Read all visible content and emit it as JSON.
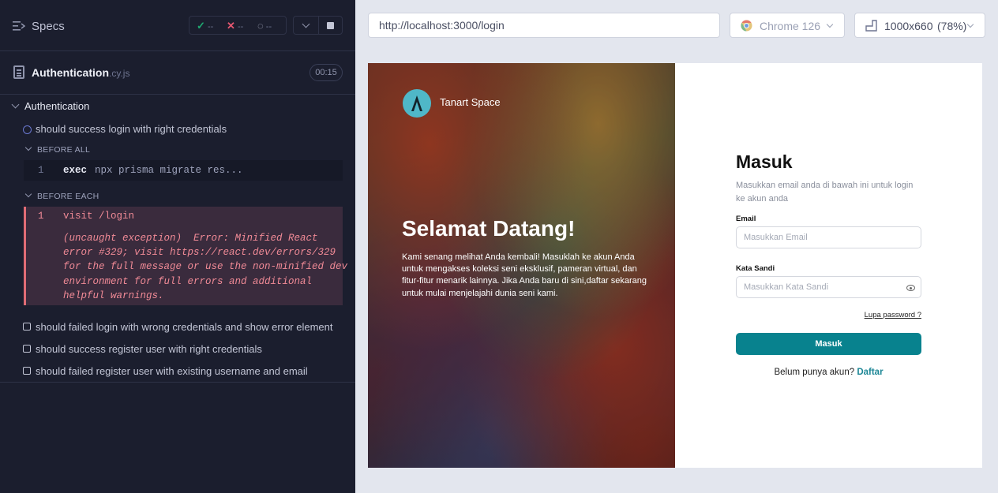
{
  "specs": {
    "title": "Specs",
    "stats": {
      "passed": "--",
      "failed": "--",
      "pending": "--"
    }
  },
  "spec_file": {
    "name": "Authentication",
    "ext": ".cy.js",
    "duration": "00:15"
  },
  "suite": {
    "name": "Authentication",
    "tests": [
      {
        "title": "should success login with right credentials",
        "state": "running"
      },
      {
        "title": "should failed login with wrong credentials and show error element",
        "state": "pending"
      },
      {
        "title": "should success register user with right credentials",
        "state": "pending"
      },
      {
        "title": "should failed register user with existing username and email",
        "state": "pending"
      }
    ],
    "before_all": {
      "label": "BEFORE ALL",
      "number": "1",
      "command": "exec",
      "message": "npx prisma migrate res..."
    },
    "before_each": {
      "label": "BEFORE EACH",
      "number": "1",
      "command": "visit",
      "message": "/login",
      "error": "(uncaught exception)  Error: Minified React\nerror #329; visit https://react.dev/errors/329\nfor the full message or use the non-minified dev\nenvironment for full errors and additional\nhelpful warnings."
    }
  },
  "browser_bar": {
    "url": "http://localhost:3000/login",
    "browser": "Chrome 126",
    "viewport": "1000x660",
    "scale": "(78%)"
  },
  "app": {
    "brand": "Tanart Space",
    "hero_title": "Selamat Datang!",
    "hero_text": "Kami senang melihat Anda kembali! Masuklah ke akun Anda untuk mengakses koleksi seni eksklusif, pameran virtual, dan fitur-fitur menarik lainnya. Jika Anda baru di sini,daftar sekarang untuk mulai menjelajahi dunia seni kami.",
    "form": {
      "title": "Masuk",
      "subtitle": "Masukkan email anda di bawah ini untuk login ke akun anda",
      "email_label": "Email",
      "email_placeholder": "Masukkan Email",
      "password_label": "Kata Sandi",
      "password_placeholder": "Masukkan Kata Sandi",
      "forgot": "Lupa password ?",
      "submit": "Masuk",
      "signup_prompt": "Belum punya akun?",
      "signup_link": "Daftar"
    }
  }
}
